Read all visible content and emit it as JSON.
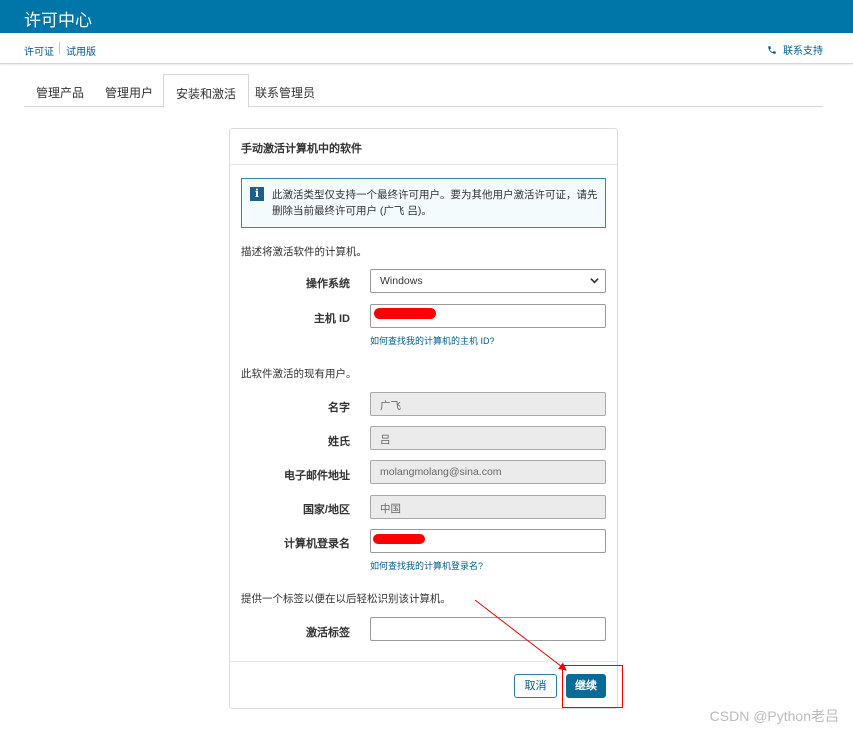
{
  "header": {
    "title": "许可中心"
  },
  "subnav": {
    "links": [
      "许可证",
      "试用版"
    ],
    "support_label": "联系支持"
  },
  "tabs": [
    {
      "label": "管理产品",
      "active": false
    },
    {
      "label": "管理用户",
      "active": false
    },
    {
      "label": "安装和激活",
      "active": true
    },
    {
      "label": "联系管理员",
      "active": false
    }
  ],
  "panel": {
    "title": "手动激活计算机中的软件",
    "info_text": "此激活类型仅支持一个最终许可用户。要为其他用户激活许可证，请先删除当前最终许可用户 (广飞 吕)。",
    "section_computer": "描述将激活软件的计算机。",
    "os_label": "操作系统",
    "os_value": "Windows",
    "host_id_label": "主机 ID",
    "host_id_help": "如何查找我的计算机的主机 ID?",
    "section_user": "此软件激活的现有用户。",
    "first_name_label": "名字",
    "first_name_value": "广飞",
    "last_name_label": "姓氏",
    "last_name_value": "吕",
    "email_label": "电子邮件地址",
    "email_value": "molangmolang@sina.com",
    "country_label": "国家/地区",
    "country_value": "中国",
    "login_label": "计算机登录名",
    "login_help": "如何查找我的计算机登录名?",
    "section_label": "提供一个标签以便在以后轻松识别该计算机。",
    "activation_label": "激活标签",
    "activation_value": "",
    "cancel_label": "取消",
    "continue_label": "继续"
  },
  "watermark": "CSDN @Python老吕",
  "colors": {
    "brand": "#0076a8",
    "link": "#005d8a",
    "annotation": "#ee0000"
  }
}
